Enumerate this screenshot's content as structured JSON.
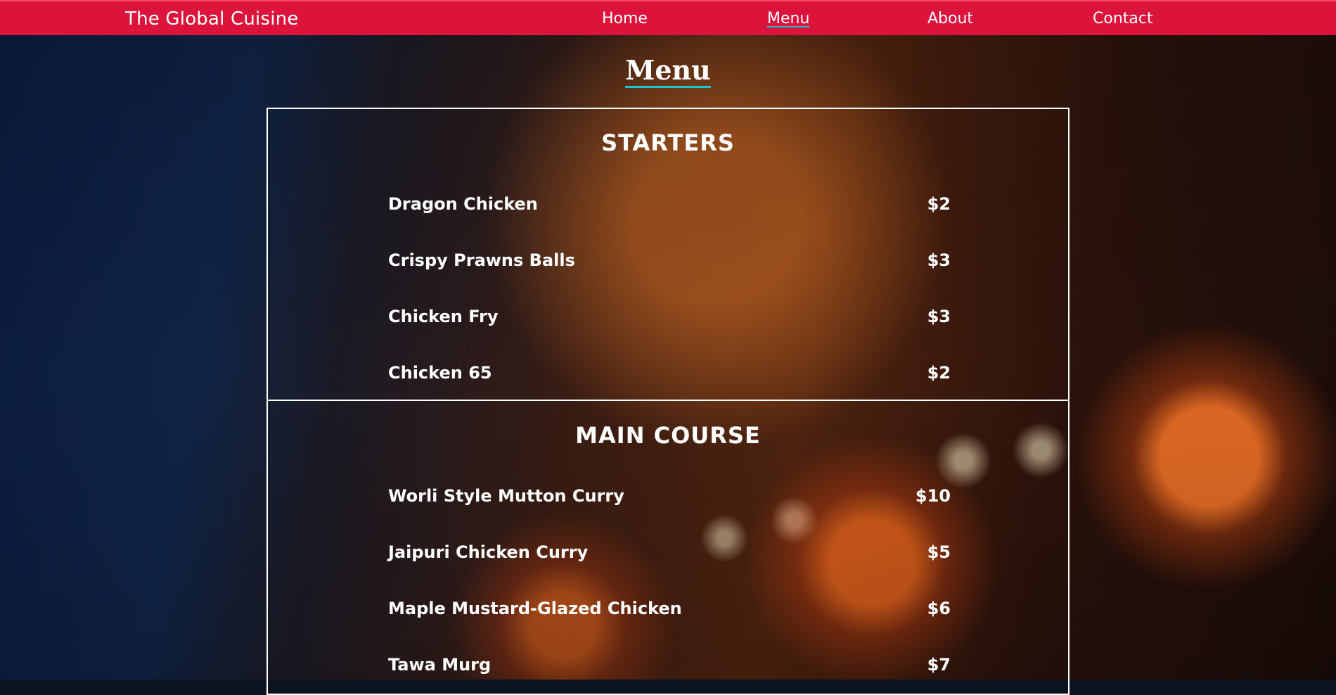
{
  "brand": "The Global Cuisine",
  "nav": {
    "home": "Home",
    "menu": "Menu",
    "about": "About",
    "contact": "Contact"
  },
  "page_title": "Menu",
  "sections": {
    "starters": {
      "title": "STARTERS",
      "items": [
        {
          "name": "Dragon Chicken",
          "price": "$2"
        },
        {
          "name": "Crispy Prawns Balls",
          "price": "$3"
        },
        {
          "name": "Chicken Fry",
          "price": "$3"
        },
        {
          "name": "Chicken 65",
          "price": "$2"
        }
      ]
    },
    "main_course": {
      "title": "MAIN COURSE",
      "items": [
        {
          "name": "Worli Style Mutton Curry",
          "price": "$10"
        },
        {
          "name": "Jaipuri Chicken Curry",
          "price": "$5"
        },
        {
          "name": "Maple Mustard-Glazed Chicken",
          "price": "$6"
        },
        {
          "name": "Tawa Murg",
          "price": "$7"
        }
      ]
    }
  },
  "colors": {
    "navbar": "#dc143c",
    "accent": "#19c6d1",
    "text": "#ffffff"
  }
}
